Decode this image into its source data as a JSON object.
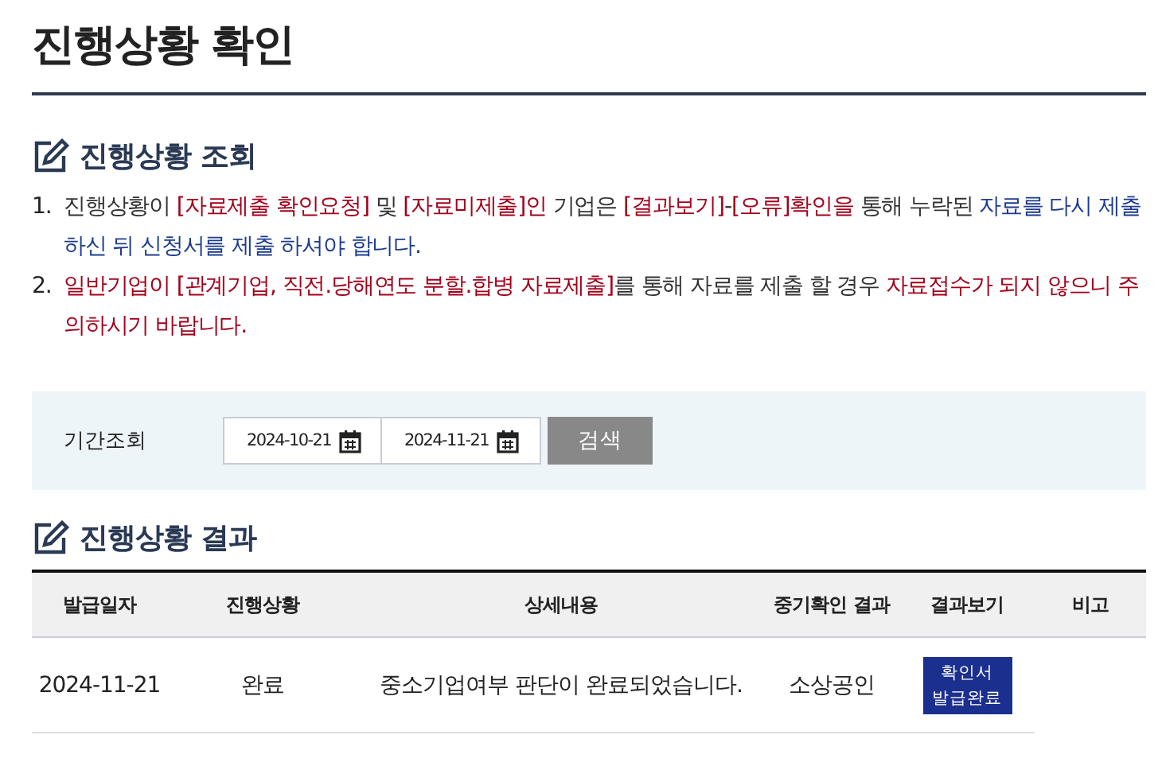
{
  "page_title": "진행상황 확인",
  "inquiry": {
    "title": "진행상황 조회",
    "notices": [
      {
        "number": "1.",
        "segments": [
          {
            "text": "진행상황이 ",
            "kind": "plain"
          },
          {
            "text": "[자료제출 확인요청]",
            "kind": "alert"
          },
          {
            "text": " 및 ",
            "kind": "plain"
          },
          {
            "text": "[자료미제출]인",
            "kind": "alert"
          },
          {
            "text": " 기업은 ",
            "kind": "plain"
          },
          {
            "text": "[결과보기]",
            "kind": "alert"
          },
          {
            "text": "-",
            "kind": "plain"
          },
          {
            "text": "[오류]확인을",
            "kind": "alert"
          },
          {
            "text": " 통해 누락된 ",
            "kind": "plain"
          },
          {
            "text": "자료를 다시 제출 하신 뒤 신청서를 제출 하셔야 합니다.",
            "kind": "info"
          }
        ]
      },
      {
        "number": "2.",
        "segments": [
          {
            "text": "일반기업이 [관계기업, 직전.당해연도 분할.합병 자료제출]",
            "kind": "alert"
          },
          {
            "text": "를 통해 자료를 제출 할 경우 ",
            "kind": "plain"
          },
          {
            "text": "자료접수가 되지 않으니 주의하시기 바랍니다.",
            "kind": "alert"
          }
        ]
      }
    ]
  },
  "period": {
    "label": "기간조회",
    "start": "2024-10-21",
    "end": "2024-11-21",
    "button": "검색"
  },
  "results": {
    "title": "진행상황 결과",
    "columns": [
      "발급일자",
      "진행상황",
      "상세내용",
      "중기확인 결과",
      "결과보기",
      "비고"
    ],
    "rows": [
      {
        "date": "2024-11-21",
        "status": "완료",
        "detail": "중소기업여부 판단이 완료되었습니다.",
        "result": "소상공인",
        "view_button": "확인서\n발급완료"
      }
    ]
  }
}
